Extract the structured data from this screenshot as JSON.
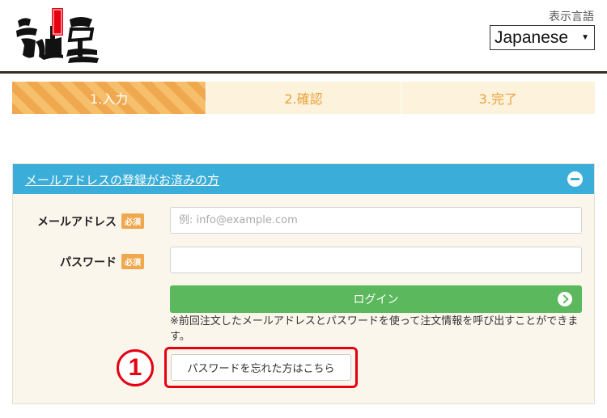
{
  "header": {
    "language_label": "表示言語",
    "language_value": "Japanese"
  },
  "steps": [
    {
      "label": "1.入力",
      "active": true
    },
    {
      "label": "2.確認",
      "active": false
    },
    {
      "label": "3.完了",
      "active": false
    }
  ],
  "login_panel": {
    "title": "メールアドレスの登録がお済みの方",
    "email_label": "メールアドレス",
    "email_required": "必須",
    "email_placeholder": "例: info@example.com",
    "password_label": "パスワード",
    "password_required": "必須",
    "login_button": "ログイン",
    "note": "※前回注文したメールアドレスとパスワードを使って注文情報を呼び出すことができます。",
    "forgot_button": "パスワードを忘れた方はこちら"
  },
  "annotation": {
    "number": "1"
  },
  "colors": {
    "accent_orange": "#f0a84e",
    "panel_header_blue": "#3aaed8",
    "login_green": "#5cb85c",
    "annotation_red": "#e60012"
  }
}
